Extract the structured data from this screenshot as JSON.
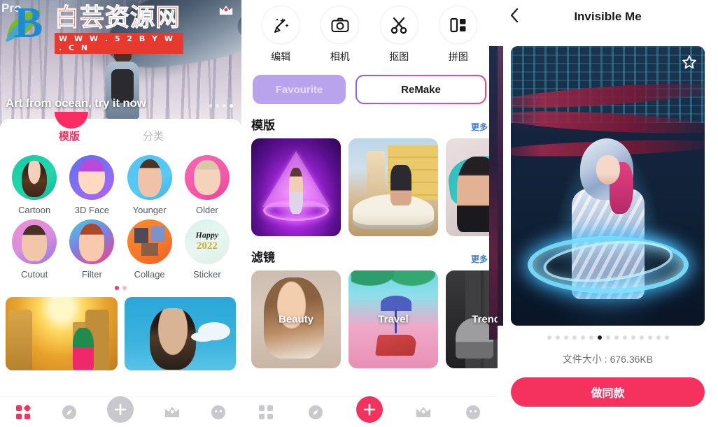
{
  "left_panel": {
    "hero": {
      "title": "Art from ocean, try it now",
      "crown_badge": "crown-badge",
      "dot_count": 4,
      "active_dot": 3
    },
    "watermark": {
      "brand_cn": "白芸资源网",
      "url": "W W W . 5 2 B Y W . C N",
      "pro_label": "Pro"
    },
    "tabs": [
      {
        "label": "模版",
        "active": true
      },
      {
        "label": "分类",
        "active": false
      }
    ],
    "categories": [
      {
        "label": "Cartoon",
        "icon": "cartoon-avatar"
      },
      {
        "label": "3D Face",
        "icon": "3d-face-avatar"
      },
      {
        "label": "Younger",
        "icon": "younger-avatar"
      },
      {
        "label": "Older",
        "icon": "older-avatar"
      },
      {
        "label": "Cutout",
        "icon": "cutout-avatar"
      },
      {
        "label": "Filter",
        "icon": "filter-avatar"
      },
      {
        "label": "Collage",
        "icon": "collage-avatar"
      },
      {
        "label": "Sticker",
        "icon": "sticker-avatar"
      }
    ],
    "page_dots": {
      "count": 2,
      "active": 1
    },
    "banners": [
      {
        "name": "temple-stairs-banner"
      },
      {
        "name": "comic-portrait-banner"
      }
    ],
    "bottom_nav": {
      "active_index": 0,
      "items": [
        {
          "icon": "grid-icon",
          "name": "nav-home"
        },
        {
          "icon": "compass-icon",
          "name": "nav-discover"
        },
        {
          "icon": "plus-icon",
          "name": "nav-create"
        },
        {
          "icon": "crown-icon",
          "name": "nav-pro"
        },
        {
          "icon": "smiley-icon",
          "name": "nav-profile"
        }
      ]
    }
  },
  "mid_panel": {
    "tools": [
      {
        "label": "编辑",
        "icon": "magic-wand-icon"
      },
      {
        "label": "相机",
        "icon": "camera-icon"
      },
      {
        "label": "抠图",
        "icon": "scissors-icon"
      },
      {
        "label": "拼图",
        "icon": "collage-layout-icon"
      }
    ],
    "buttons": {
      "favourite": "Favourite",
      "remake": "ReMake"
    },
    "sections": [
      {
        "title": "模版",
        "more": "更多",
        "cards": [
          {
            "label": "",
            "name": "template-card-neon"
          },
          {
            "label": "",
            "name": "template-card-car"
          },
          {
            "label": "",
            "name": "template-card-splash"
          }
        ]
      },
      {
        "title": "滤镜",
        "more": "更多",
        "cards": [
          {
            "label": "Beauty",
            "name": "filter-card-beauty"
          },
          {
            "label": "Travel",
            "name": "filter-card-travel"
          },
          {
            "label": "Trend",
            "name": "filter-card-trend"
          }
        ]
      }
    ],
    "bottom_nav": {
      "active_index": 2,
      "items": [
        {
          "icon": "grid-icon",
          "name": "nav-home"
        },
        {
          "icon": "compass-icon",
          "name": "nav-discover"
        },
        {
          "icon": "plus-icon",
          "name": "nav-create"
        },
        {
          "icon": "crown-icon",
          "name": "nav-pro"
        },
        {
          "icon": "smiley-icon",
          "name": "nav-profile"
        }
      ]
    }
  },
  "right_panel": {
    "back_icon": "chevron-left-icon",
    "title": "Invisible Me",
    "preview": {
      "name": "cyberpunk-hooded-figure-preview",
      "favorite_icon": "star-outline-icon"
    },
    "carousel": {
      "count": 15,
      "active": 7
    },
    "file_size_label": "文件大小 : 676.36KB",
    "cta_label": "做同款"
  },
  "colors": {
    "accent_pink": "#f5325e",
    "tab_active": "#fb2c63",
    "favourite_bg": "#b8a3ec",
    "remake_gradient_start": "#8b5cf0",
    "remake_gradient_end": "#f0437f",
    "more_link": "#3f7bd6",
    "watermark_red": "#e8392f",
    "watermark_blue": "#1e8bd0"
  }
}
